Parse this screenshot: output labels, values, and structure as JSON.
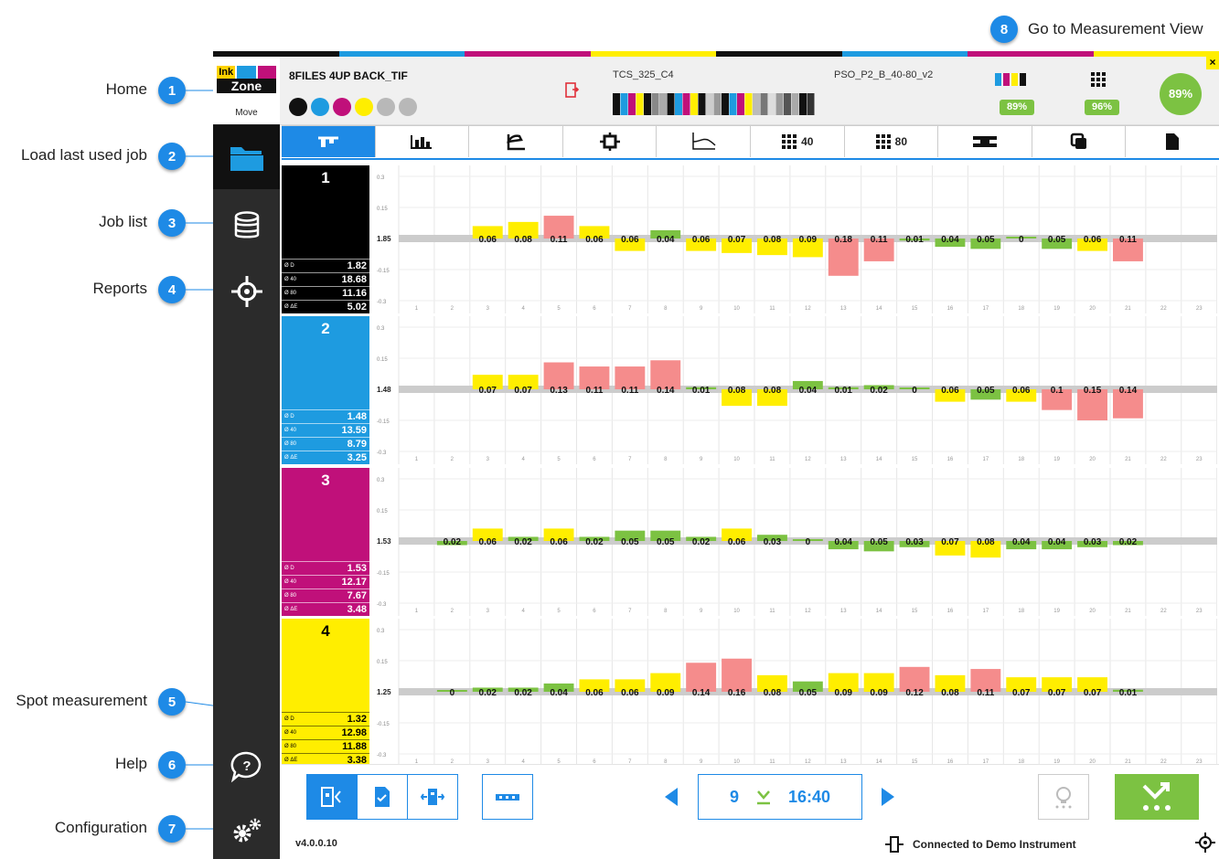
{
  "callouts": [
    {
      "num": "1",
      "label": "Home"
    },
    {
      "num": "2",
      "label": "Load last used job"
    },
    {
      "num": "3",
      "label": "Job list"
    },
    {
      "num": "4",
      "label": "Reports"
    },
    {
      "num": "5",
      "label": "Spot measurement"
    },
    {
      "num": "6",
      "label": "Help"
    },
    {
      "num": "7",
      "label": "Configuration"
    },
    {
      "num": "8",
      "label": "Go to Measurement View"
    }
  ],
  "logo": {
    "line1": "Ink",
    "line2": "Zone",
    "sub": "Move"
  },
  "header": {
    "job_name": "8FILES 4UP BACK_TIF",
    "colorbar_name": "TCS_325_C4",
    "standard_name": "PSO_P2_B_40-80_v2",
    "score_solids": "89%",
    "score_tones": "96%",
    "score_total": "89%",
    "close": "×",
    "ink_dots": [
      "#111111",
      "#1e9be0",
      "#c0107a",
      "#ffee00",
      "#b8b8b8",
      "#b8b8b8"
    ]
  },
  "tabs": [
    "",
    "",
    "",
    "",
    "",
    "40",
    "80",
    "",
    "",
    ""
  ],
  "zones": [
    "1",
    "2",
    "3",
    "4",
    "5",
    "6",
    "7",
    "8",
    "9",
    "10",
    "11",
    "12",
    "13",
    "14",
    "15",
    "16",
    "17",
    "18",
    "19",
    "20",
    "21",
    "22",
    "23"
  ],
  "y_ticks": [
    "0.3",
    "0.15",
    "-0.15",
    "-0.3"
  ],
  "lanes": [
    {
      "num": "1",
      "color": "#000000",
      "text": "#ffffff",
      "center": "1.82",
      "center_label": "1.85",
      "stats": [
        {
          "k": "Ø D",
          "v": "1.82"
        },
        {
          "k": "Ø 40",
          "v": "18.68"
        },
        {
          "k": "Ø 80",
          "v": "11.16"
        },
        {
          "k": "Ø ΔE",
          "v": "5.02"
        }
      ],
      "values": [
        null,
        null,
        0.06,
        0.08,
        0.11,
        0.06,
        -0.06,
        0.04,
        -0.06,
        -0.07,
        -0.08,
        -0.09,
        -0.18,
        -0.11,
        -0.01,
        -0.04,
        -0.05,
        0,
        -0.05,
        -0.06,
        -0.11,
        null,
        null
      ]
    },
    {
      "num": "2",
      "color": "#1e9be0",
      "text": "#ffffff",
      "center": "1.48",
      "center_label": "1.48",
      "stats": [
        {
          "k": "Ø D",
          "v": "1.48"
        },
        {
          "k": "Ø 40",
          "v": "13.59"
        },
        {
          "k": "Ø 80",
          "v": "8.79"
        },
        {
          "k": "Ø ΔE",
          "v": "3.25"
        }
      ],
      "values": [
        null,
        null,
        0.07,
        0.07,
        0.13,
        0.11,
        0.11,
        0.14,
        0.01,
        -0.08,
        -0.08,
        0.04,
        0.01,
        0.02,
        0,
        -0.06,
        -0.05,
        -0.06,
        -0.1,
        -0.15,
        -0.14,
        null,
        null
      ]
    },
    {
      "num": "3",
      "color": "#c0107a",
      "text": "#ffffff",
      "center": "1.53",
      "center_label": "1.53",
      "stats": [
        {
          "k": "Ø D",
          "v": "1.53"
        },
        {
          "k": "Ø 40",
          "v": "12.17"
        },
        {
          "k": "Ø 80",
          "v": "7.67"
        },
        {
          "k": "Ø ΔE",
          "v": "3.48"
        }
      ],
      "values": [
        null,
        -0.02,
        0.06,
        0.02,
        0.06,
        0.02,
        0.05,
        0.05,
        0.02,
        0.06,
        0.03,
        0,
        -0.04,
        -0.05,
        -0.03,
        -0.07,
        -0.08,
        -0.04,
        -0.04,
        -0.03,
        -0.02,
        null,
        null
      ]
    },
    {
      "num": "4",
      "color": "#ffee00",
      "text": "#000000",
      "center": "1.32",
      "center_label": "1.25",
      "stats": [
        {
          "k": "Ø D",
          "v": "1.32"
        },
        {
          "k": "Ø 40",
          "v": "12.98"
        },
        {
          "k": "Ø 80",
          "v": "11.88"
        },
        {
          "k": "Ø ΔE",
          "v": "3.38"
        }
      ],
      "values": [
        null,
        0,
        0.02,
        0.02,
        0.04,
        0.06,
        0.06,
        0.09,
        0.14,
        0.16,
        0.08,
        0.05,
        0.09,
        0.09,
        0.12,
        0.08,
        0.11,
        0.07,
        0.07,
        0.07,
        0.01,
        null,
        null
      ]
    }
  ],
  "footer": {
    "nav_value": "9",
    "nav_time": "16:40",
    "version": "v4.0.0.10",
    "status": "Connected to Demo Instrument"
  },
  "colors": {
    "accent": "#1e8ae6",
    "ok": "#7cc242",
    "warn": "#ffee00",
    "bad": "#f58c8c",
    "sidebar": "#2b2b2b"
  }
}
